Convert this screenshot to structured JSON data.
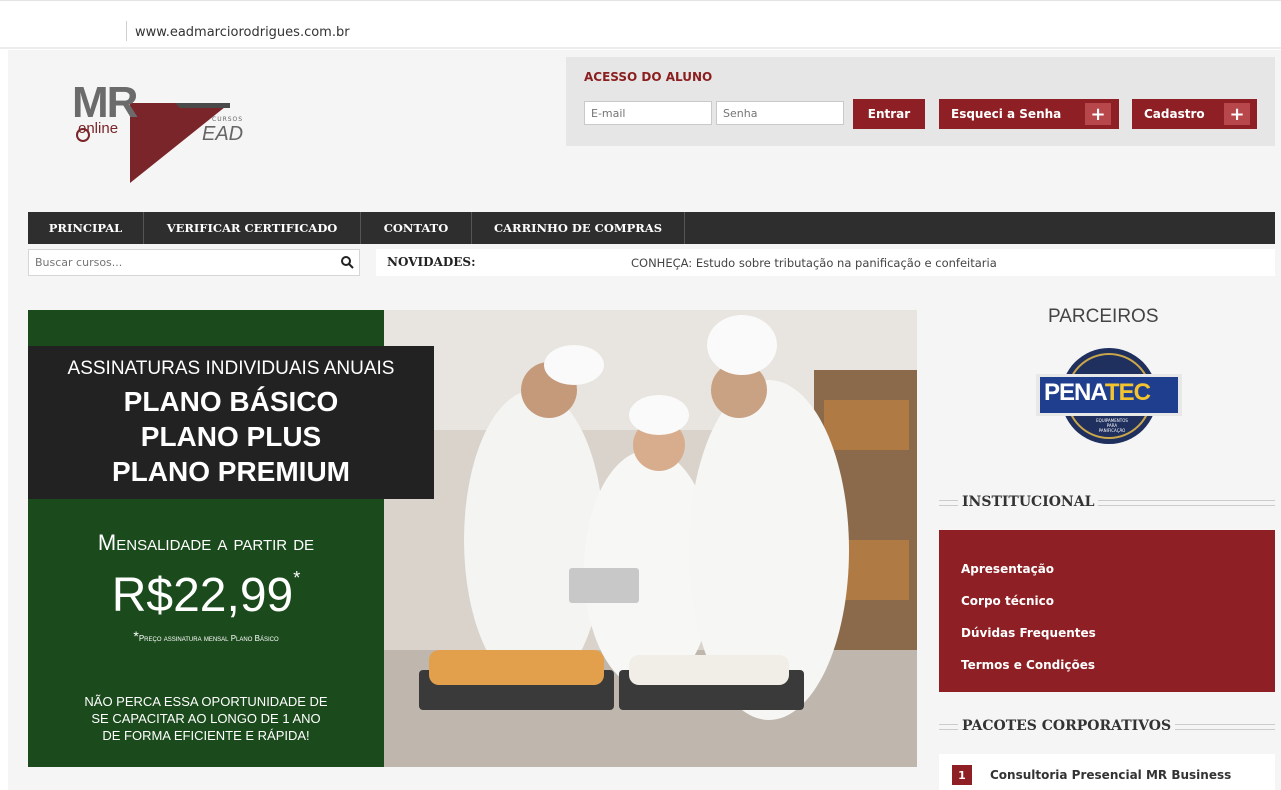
{
  "browser": {
    "url": "www.eadmarciorodrigues.com.br"
  },
  "logo": {
    "mr": "MR",
    "online": "online",
    "cursos": "CURSOS",
    "ead": "EAD"
  },
  "login": {
    "title": "ACESSO DO ALUNO",
    "email_placeholder": "E-mail",
    "senha_placeholder": "Senha",
    "entrar_label": "Entrar",
    "esqueci_label": "Esqueci a Senha",
    "cadastro_label": "Cadastro",
    "plus": "+"
  },
  "nav": {
    "items": [
      {
        "label": "PRINCIPAL"
      },
      {
        "label": "VERIFICAR CERTIFICADO"
      },
      {
        "label": "CONTATO"
      },
      {
        "label": "CARRINHO DE COMPRAS"
      }
    ]
  },
  "search": {
    "placeholder": "Buscar cursos..."
  },
  "novidades": {
    "label": "NOVIDADES:",
    "text": "CONHEÇA: Estudo sobre tributação na panificação e confeitaria"
  },
  "banner": {
    "line1": "ASSINATURAS INDIVIDUAIS ANUAIS",
    "plan1": "PLANO BÁSICO",
    "plan2": "PLANO PLUS",
    "plan3": "PLANO PREMIUM",
    "mensalidade": "Mensalidade a partir de",
    "price": "R$22,99",
    "price_star": "*",
    "note_star": "*",
    "note": "Preço assinatura mensal Plano Básico",
    "cta1": "NÃO PERCA ESSA OPORTUNIDADE DE",
    "cta2": "SE CAPACITAR AO LONGO DE 1 ANO",
    "cta3": "DE FORMA EFICIENTE E RÁPIDA!"
  },
  "sidebar": {
    "parceiros_title": "PARCEIROS",
    "partner": {
      "name_a": "PENA",
      "name_b": "TEC",
      "tagline1": "EQUIPAMENTOS PARA",
      "tagline2": "PANIFICAÇÃO"
    },
    "institucional_title": "INSTITUCIONAL",
    "institucional_links": [
      {
        "label": "Apresentação"
      },
      {
        "label": "Corpo técnico"
      },
      {
        "label": "Dúvidas Frequentes"
      },
      {
        "label": "Termos e Condições"
      }
    ],
    "pacotes_title": "PACOTES CORPORATIVOS",
    "pacotes": [
      {
        "num": "1",
        "label": "Consultoria Presencial MR Business"
      }
    ]
  },
  "colors": {
    "brand_red": "#8e2025",
    "nav_dark": "#2e2e2e",
    "banner_green": "#1b4b1c"
  }
}
